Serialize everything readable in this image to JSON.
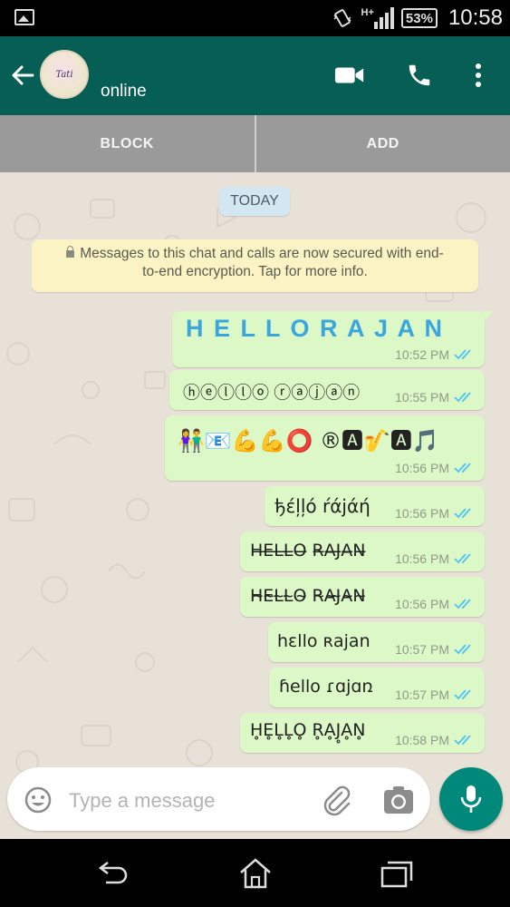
{
  "status_bar": {
    "network": "H+",
    "battery": "53%",
    "time": "10:58"
  },
  "header": {
    "avatar_text": "Tati",
    "contact_status": "online"
  },
  "actions": {
    "block_label": "BLOCK",
    "add_label": "ADD"
  },
  "chat": {
    "date_label": "TODAY",
    "encryption_notice_line1": "Messages to this chat and calls are now secured with end-",
    "encryption_notice_line2": "to-end encryption. Tap for more info.",
    "messages": [
      {
        "text": "H E L L O R A J A N",
        "time": "10:52 PM"
      },
      {
        "text": "ⓗⓔⓛⓛⓞ ⓡⓐⓙⓐⓝ",
        "time": "10:55 PM"
      },
      {
        "text": "👫📧💪💪⭕ ®🅰🎷🅰🎵",
        "time": "10:56 PM"
      },
      {
        "text": "ђέļļό ŕάјάή",
        "time": "10:56 PM"
      },
      {
        "text": "H̶E̶L̶L̶O̶ R̶A̶J̶A̶N̶",
        "time": "10:56 PM"
      },
      {
        "text": "H̴E̴L̴L̴O̴ R̴A̴J̴A̴N̴",
        "time": "10:56 PM"
      },
      {
        "text": "hɛllo ʀajan",
        "time": "10:57 PM"
      },
      {
        "text": "ɦello ɾɑjɑռ",
        "time": "10:57 PM"
      },
      {
        "text": "H̥E̥L̥L̥O̥ R̥ḀJ̥ḀN̥",
        "time": "10:58 PM"
      }
    ]
  },
  "composer": {
    "placeholder": "Type a message"
  },
  "colors": {
    "header": "#075E54",
    "outgoing_bubble": "#dcf8c6",
    "fab": "#00897B",
    "read_ticks": "#4fc3f7"
  }
}
